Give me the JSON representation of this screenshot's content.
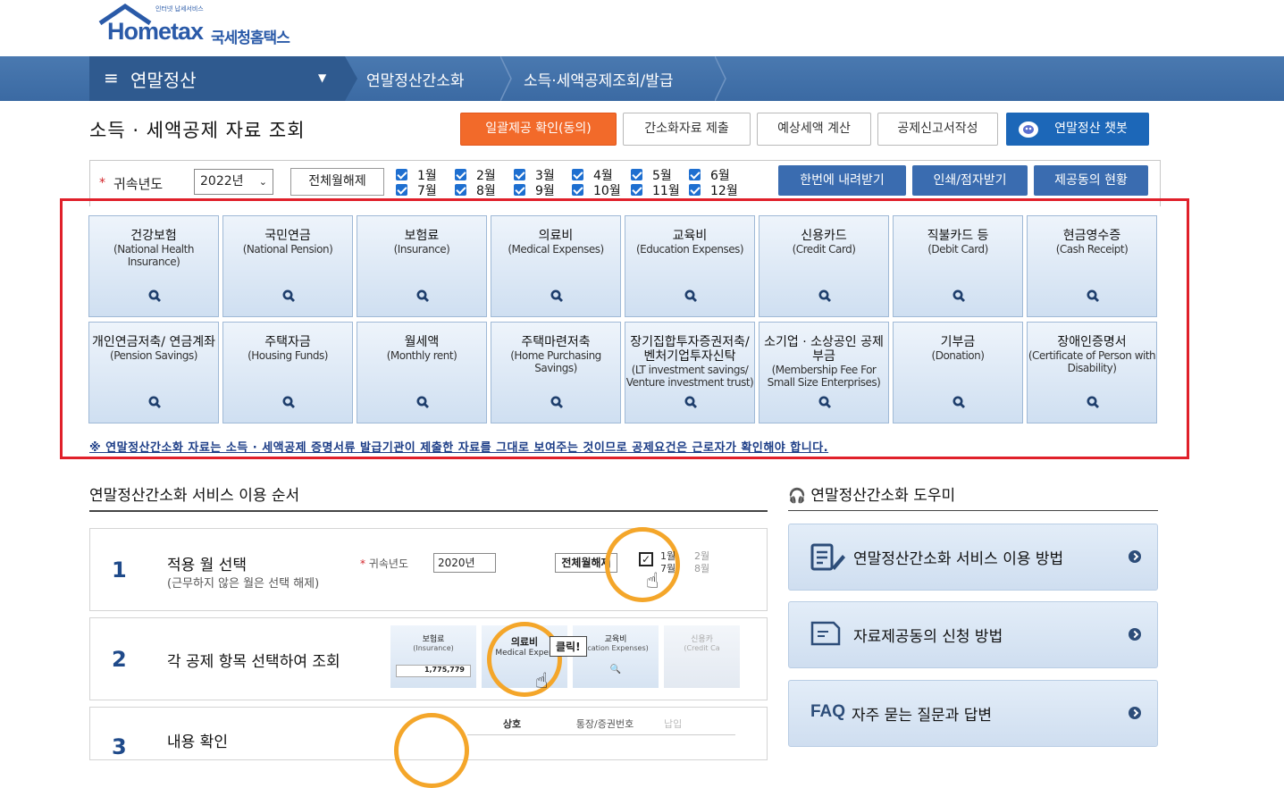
{
  "logo": {
    "brand": "Hometax",
    "ko": "국세청홈택스",
    "tagline": "인터넷 납세서비스"
  },
  "nav": {
    "menu": "연말정산",
    "crumbs": [
      "연말정산간소화",
      "소득·세액공제조회/발급"
    ]
  },
  "page": {
    "title": "소득 · 세액공제 자료 조회",
    "buttons": {
      "consent": "일괄제공 확인(동의)",
      "submit": "간소화자료 제출",
      "estimate": "예상세액 계산",
      "report": "공제신고서작성",
      "chatbot": "연말정산 챗봇"
    }
  },
  "filter": {
    "year_label": "귀속년도",
    "year_value": "2022년",
    "clear_label": "전체월해제",
    "months": [
      "1월",
      "2월",
      "3월",
      "4월",
      "5월",
      "6월",
      "7월",
      "8월",
      "9월",
      "10월",
      "11월",
      "12월"
    ],
    "download": "한번에 내려받기",
    "print": "인쇄/점자받기",
    "consent_status": "제공동의 현황"
  },
  "categories": [
    {
      "ko": "건강보험",
      "en": "(National Health Insurance)"
    },
    {
      "ko": "국민연금",
      "en": "(National Pension)"
    },
    {
      "ko": "보험료",
      "en": "(Insurance)"
    },
    {
      "ko": "의료비",
      "en": "(Medical Expenses)"
    },
    {
      "ko": "교육비",
      "en": "(Education Expenses)"
    },
    {
      "ko": "신용카드",
      "en": "(Credit Card)"
    },
    {
      "ko": "직불카드 등",
      "en": "(Debit Card)"
    },
    {
      "ko": "현금영수증",
      "en": "(Cash Receipt)"
    },
    {
      "ko": "개인연금저축/ 연금계좌",
      "en": "(Pension Savings)"
    },
    {
      "ko": "주택자금",
      "en": "(Housing Funds)"
    },
    {
      "ko": "월세액",
      "en": "(Monthly rent)"
    },
    {
      "ko": "주택마련저축",
      "en": "(Home Purchasing Savings)"
    },
    {
      "ko": "장기집합투자증권저축/ 벤처기업투자신탁",
      "en": "(LT investment savings/ Venture investment trust)"
    },
    {
      "ko": "소기업 · 소상공인 공제부금",
      "en": "(Membership Fee For Small Size Enterprises)"
    },
    {
      "ko": "기부금",
      "en": "(Donation)"
    },
    {
      "ko": "장애인증명서",
      "en": "(Certificate of Person with Disability)"
    }
  ],
  "notice": "※ 연말정산간소화 자료는 소득 · 세액공제 증명서류 발급기관이 제출한 자료를 그대로 보여주는 것이므로 공제요건은 근로자가 확인해야 합니다.",
  "steps_title": "연말정산간소화 서비스 이용 순서",
  "steps": [
    {
      "num": "1",
      "title": "적용 월 선택",
      "sub": "(근무하지 않은 월은 선택 해제)"
    },
    {
      "num": "2",
      "title": "각 공제 항목 선택하여 조회",
      "sub": ""
    },
    {
      "num": "3",
      "title": "내용 확인",
      "sub": ""
    }
  ],
  "step_illustrations": {
    "s1": {
      "year_label": "귀속년도",
      "year": "2020년",
      "clear": "전체월해제",
      "m1": "1월",
      "m2": "2월",
      "m7": "7월",
      "m8": "8월"
    },
    "s2": {
      "c1": "보험료",
      "c1en": "(Insurance)",
      "c1val": "1,775,779",
      "c2": "의료비",
      "c2en": "Medical Expen",
      "click": "클릭!",
      "c3": "교육비",
      "c3en": "ucation Expenses)",
      "c4": "신용카",
      "c4en": "(Credit Ca"
    },
    "s3": {
      "h1": "상호",
      "h2": "통장/증권번호",
      "h3": "납입"
    }
  },
  "help_title": "연말정산간소화 도우미",
  "help": [
    {
      "label": "연말정산간소화 서비스 이용 방법"
    },
    {
      "label": "자료제공동의 신청 방법"
    },
    {
      "label": "자주 묻는 질문과 답변",
      "prefix": "FAQ"
    }
  ],
  "colors": {
    "nav": "#3b6aa3",
    "orange": "#f26a2a",
    "blue_btn": "#1c67b8",
    "highlight": "#e0202a"
  }
}
